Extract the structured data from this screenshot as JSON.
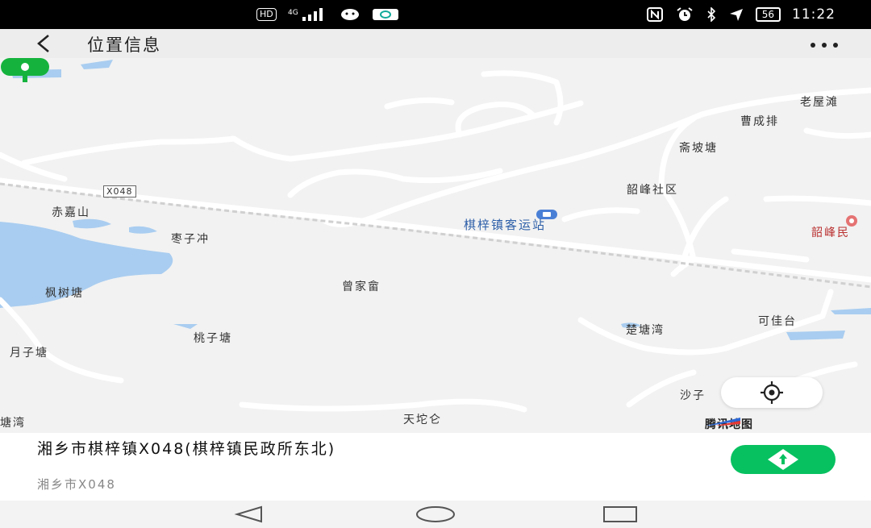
{
  "status_bar": {
    "left_indicators": [
      "HD",
      "4G",
      "signal-icon",
      "wechat-bubble-icon",
      "message-icon"
    ],
    "hd_badge": "HD",
    "right_indicators": [
      "nfc-icon",
      "alarm-icon",
      "bluetooth-icon",
      "location-icon",
      "battery-icon"
    ],
    "battery": "56",
    "time": "11:22"
  },
  "header": {
    "back_icon": "back-arrow-icon",
    "title": "位置信息",
    "more_icon": "more-dots-icon"
  },
  "map": {
    "labels": {
      "laowutan": "老屋滩",
      "caochengpai": "曹成排",
      "qipotang": "斋坡塘",
      "shaofeng_community": "韶峰社区",
      "shaofeng_partial": "韶峰民",
      "road_x048": "X048",
      "chijiashan": "赤嘉山",
      "zaozichong": "枣子冲",
      "bus_station": "棋梓镇客运站",
      "zengjiaqi": "曾家畲",
      "fengshutang": "枫树塘",
      "taozitang": "桃子塘",
      "yuezitang": "月子塘",
      "jitangwan": "楚塘湾",
      "kejiatai": "可佳台",
      "shazi_partial": "沙子",
      "tuocang": "天坨仑",
      "tangwan_partial": "塘湾"
    },
    "pin_icon": "location-pin-icon",
    "locate_icon": "locate-crosshair-icon",
    "provider": "腾讯地图",
    "provider_icon": "tencent-map-logo-icon",
    "colors": {
      "pin": "#15b33d",
      "water": "#a9cdf0",
      "road": "#ffffff"
    }
  },
  "location": {
    "address": "湘乡市棋梓镇X048(棋梓镇民政所东北)",
    "sub_address": "湘乡市X048",
    "navigate_icon": "navigate-arrow-icon",
    "colors": {
      "navigate_button": "#07c160"
    }
  },
  "nav_bar": {
    "back_icon": "triangle-back-icon",
    "home_icon": "circle-home-icon",
    "recents_icon": "square-recents-icon"
  }
}
